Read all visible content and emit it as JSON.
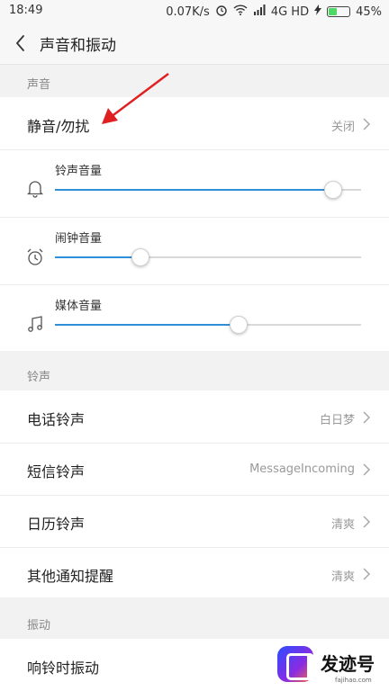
{
  "status_bar": {
    "time": "18:49",
    "net_speed": "0.07K/s",
    "network": "4G HD",
    "battery": "45%",
    "battery_level": 0.45
  },
  "title_bar": {
    "title": "声音和振动"
  },
  "sound_section": {
    "label": "声音",
    "mute": {
      "label": "静音/勿扰",
      "value": "关闭"
    },
    "volumes": [
      {
        "label": "铃声音量",
        "icon": "bell-icon",
        "level": 0.91
      },
      {
        "label": "闹钟音量",
        "icon": "alarm-clock-icon",
        "level": 0.28
      },
      {
        "label": "媒体音量",
        "icon": "music-note-icon",
        "level": 0.6
      }
    ]
  },
  "ringtone_section": {
    "label": "铃声",
    "items": [
      {
        "label": "电话铃声",
        "value": "白日梦"
      },
      {
        "label": "短信铃声",
        "value": "MessageIncoming"
      },
      {
        "label": "日历铃声",
        "value": "清爽"
      },
      {
        "label": "其他通知提醒",
        "value": "清爽"
      }
    ]
  },
  "vibration_section": {
    "label": "振动",
    "items": [
      {
        "label": "响铃时振动"
      }
    ]
  },
  "watermark": {
    "brand": "发迹号",
    "domain": "fajihao.com"
  },
  "colors": {
    "accent": "#2f8fd8",
    "annotation_arrow": "#e02020"
  }
}
